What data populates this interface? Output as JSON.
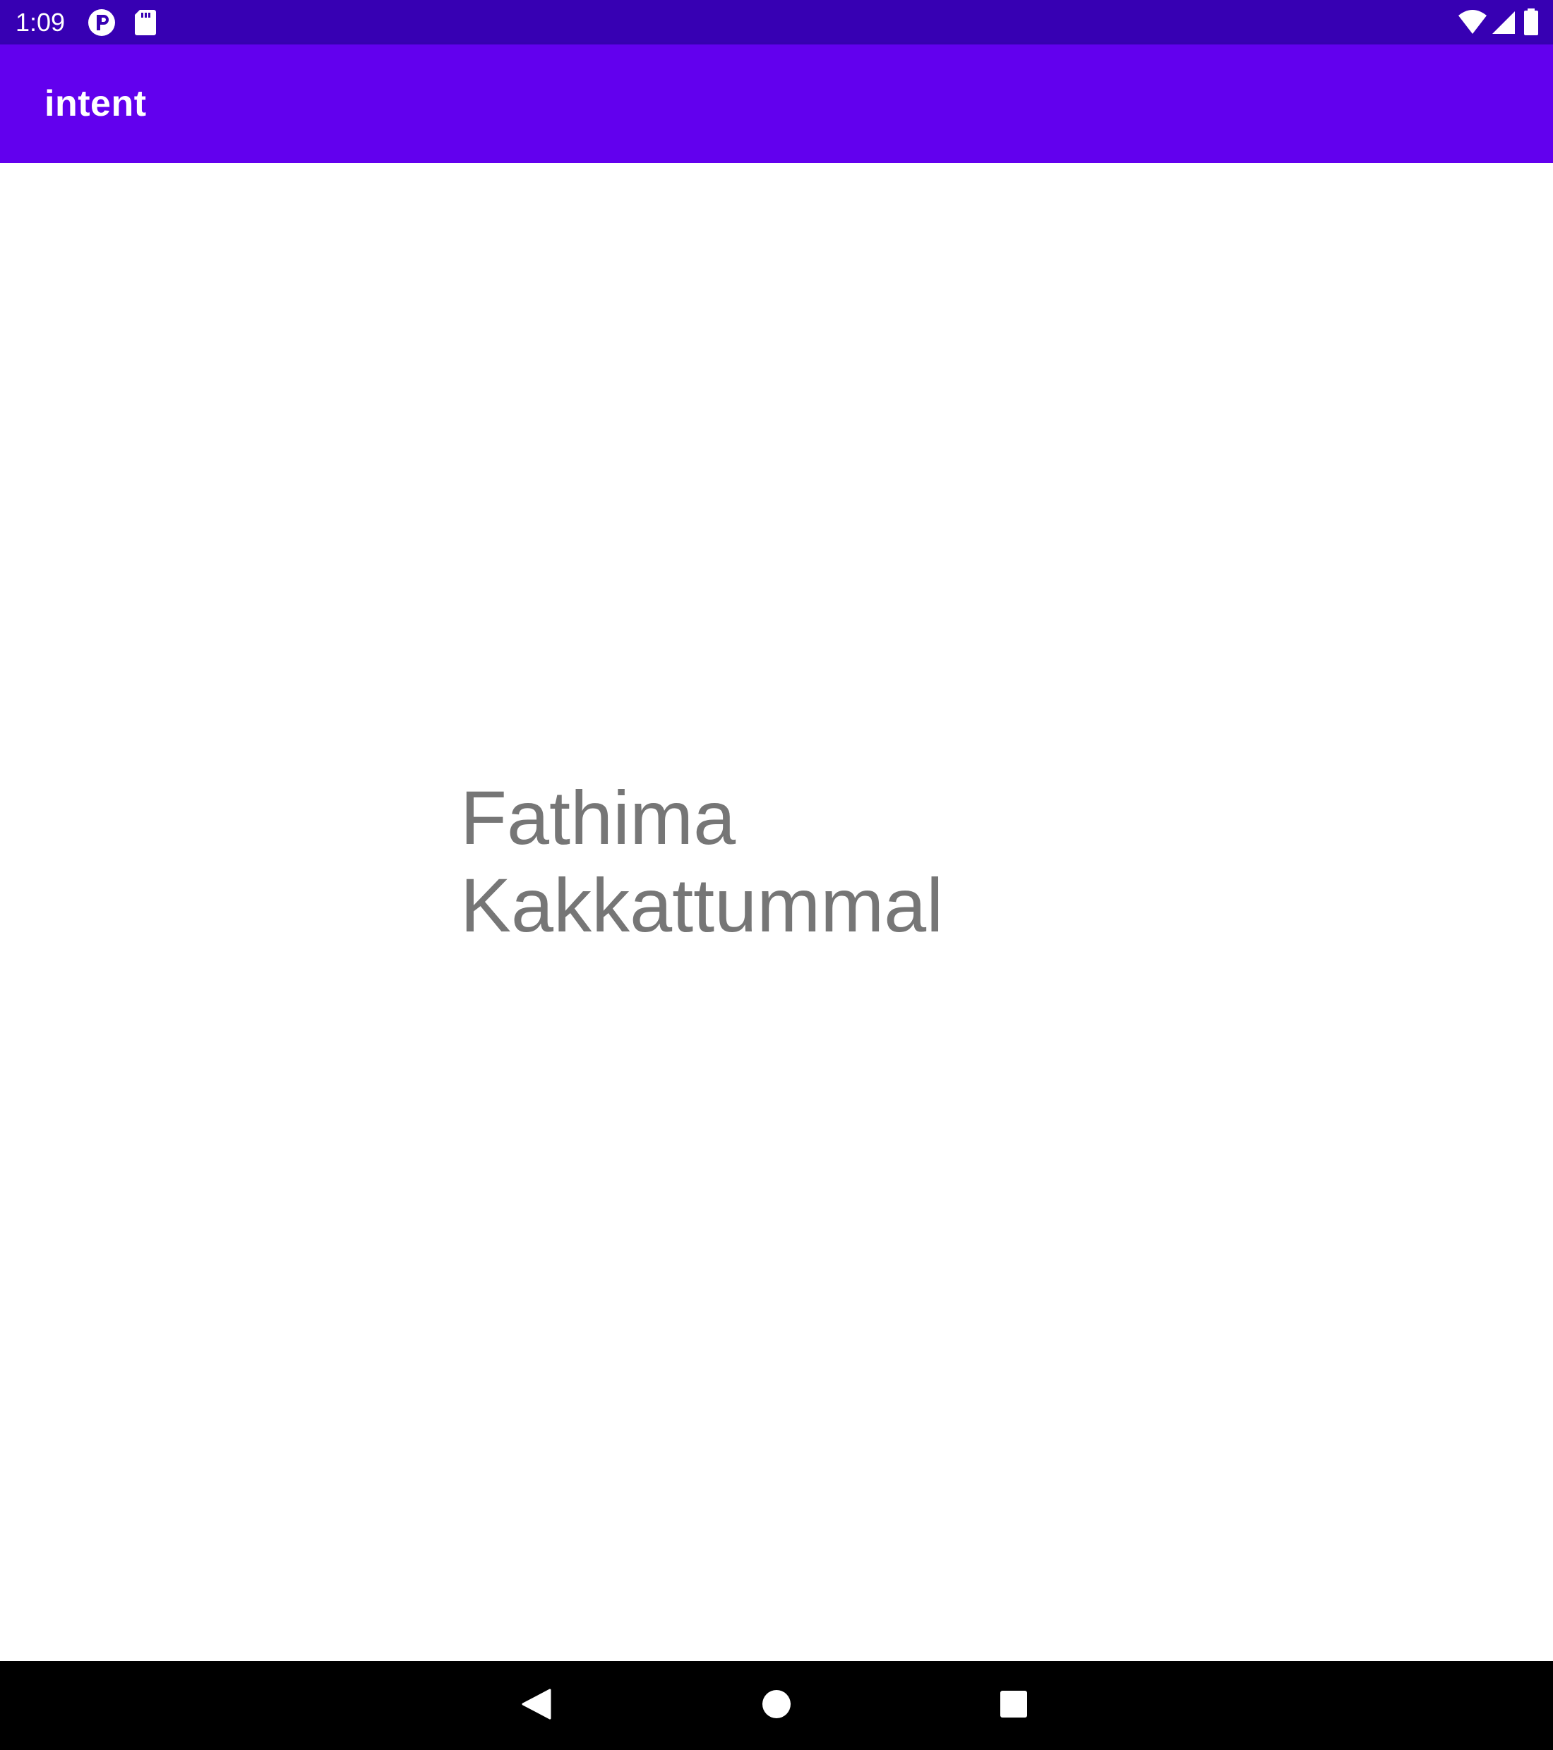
{
  "status_bar": {
    "time": "1:09",
    "icons": [
      "p-badge-icon",
      "sd-card-icon",
      "wifi-icon",
      "cell-signal-icon",
      "battery-icon"
    ],
    "color": "#3700b3"
  },
  "app_bar": {
    "title": "intent",
    "color": "#6200ee"
  },
  "content": {
    "name_line1": "Fathima",
    "name_line2": "Kakkattummal",
    "text_color": "#767676"
  },
  "nav_bar": {
    "buttons": [
      "back-icon",
      "home-icon",
      "recents-icon"
    ]
  }
}
